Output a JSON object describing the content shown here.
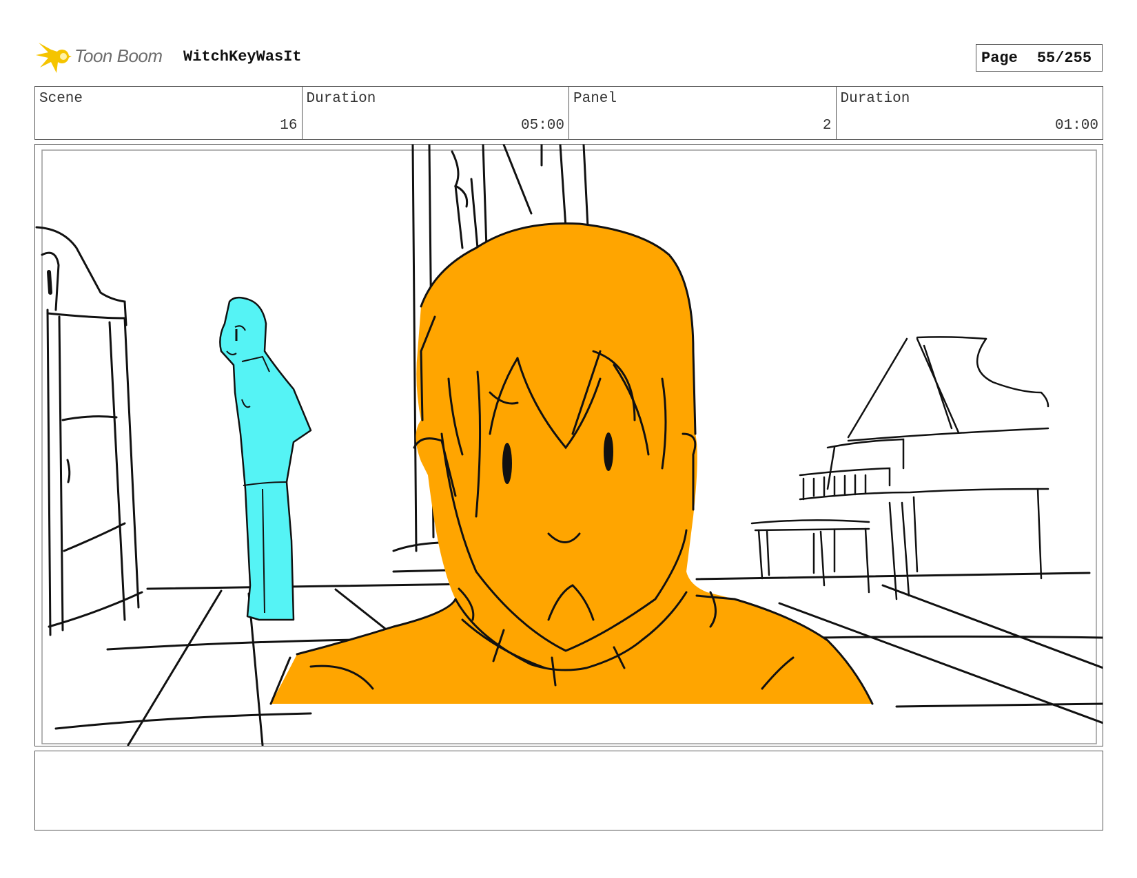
{
  "header": {
    "logo_text": "Toon Boom",
    "project_title": "WitchKeyWasIt",
    "page_label": "Page",
    "page_value": "55/255"
  },
  "info": {
    "scene_label": "Scene",
    "scene_value": "16",
    "scene_duration_label": "Duration",
    "scene_duration_value": "05:00",
    "panel_label": "Panel",
    "panel_value": "2",
    "panel_duration_label": "Duration",
    "panel_duration_value": "01:00"
  },
  "colors": {
    "foreground_character": "#FFA500",
    "background_character": "#55F3F5",
    "logo_star": "#F5C400"
  },
  "notes": {
    "text": ""
  }
}
